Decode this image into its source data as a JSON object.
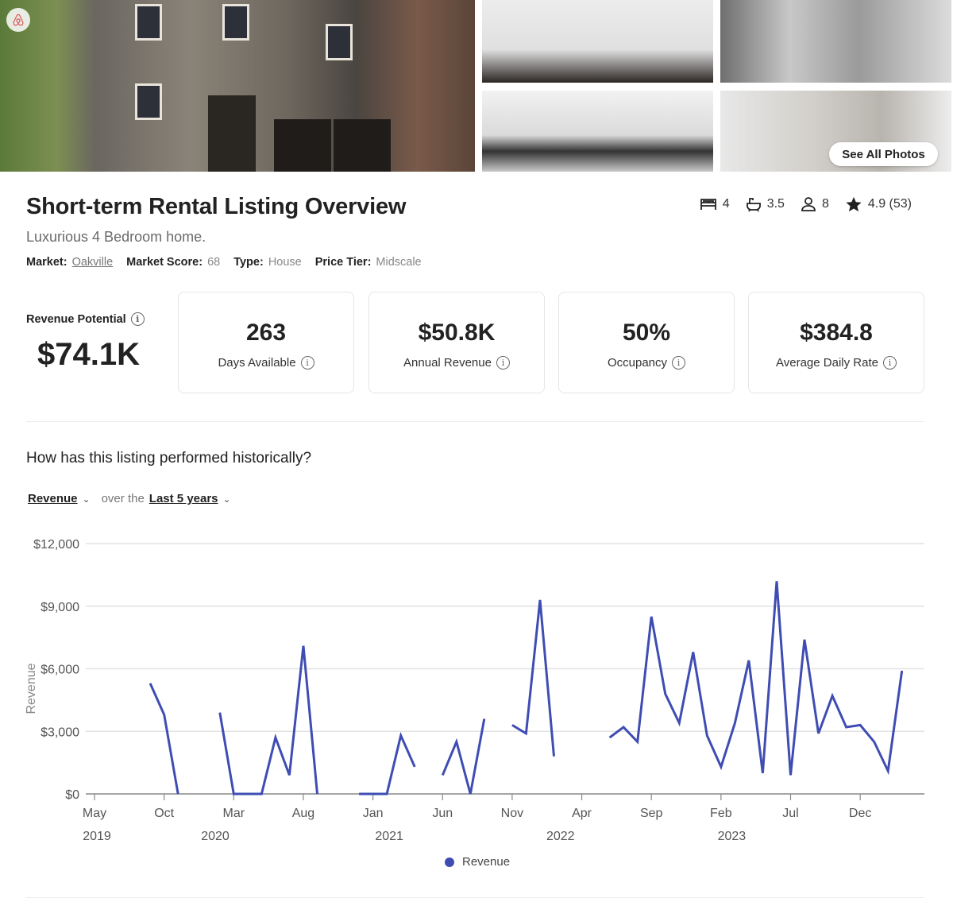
{
  "photos": {
    "see_all_label": "See All Photos"
  },
  "header": {
    "title": "Short-term Rental Listing Overview",
    "subtitle": "Luxurious 4 Bedroom home.",
    "meta": [
      {
        "label": "Market:",
        "value": "Oakville"
      },
      {
        "label": "Market Score:",
        "value": "68"
      },
      {
        "label": "Type:",
        "value": "House"
      },
      {
        "label": "Price Tier:",
        "value": "Midscale"
      }
    ],
    "stats": {
      "bedrooms": "4",
      "bathrooms": "3.5",
      "guests": "8",
      "rating": "4.9 (53)"
    }
  },
  "revenue_potential": {
    "label": "Revenue Potential",
    "value": "$74.1K"
  },
  "cards": [
    {
      "value": "263",
      "label": "Days Available"
    },
    {
      "value": "$50.8K",
      "label": "Annual Revenue"
    },
    {
      "value": "50%",
      "label": "Occupancy"
    },
    {
      "value": "$384.8",
      "label": "Average Daily Rate"
    }
  ],
  "history": {
    "question": "How has this listing performed historically?",
    "metric": "Revenue",
    "connector": "over the",
    "period": "Last 5 years"
  },
  "colors": {
    "line": "#3f4db3"
  },
  "chart_data": {
    "type": "line",
    "ylabel": "Revenue",
    "xlabel": "",
    "ylim": [
      0,
      12000
    ],
    "y_ticks": [
      "$0",
      "$3,000",
      "$6,000",
      "$9,000",
      "$12,000"
    ],
    "y_tick_values": [
      0,
      3000,
      6000,
      9000,
      12000
    ],
    "x_start_month": "2019-05",
    "x_ticks": [
      {
        "month_index": 0,
        "label": "May"
      },
      {
        "month_index": 5,
        "label": "Oct"
      },
      {
        "month_index": 10,
        "label": "Mar"
      },
      {
        "month_index": 15,
        "label": "Aug"
      },
      {
        "month_index": 20,
        "label": "Jan"
      },
      {
        "month_index": 25,
        "label": "Jun"
      },
      {
        "month_index": 30,
        "label": "Nov"
      },
      {
        "month_index": 35,
        "label": "Apr"
      },
      {
        "month_index": 40,
        "label": "Sep"
      },
      {
        "month_index": 45,
        "label": "Feb"
      },
      {
        "month_index": 50,
        "label": "Jul"
      },
      {
        "month_index": 55,
        "label": "Dec"
      }
    ],
    "year_labels": [
      {
        "month_index": 0,
        "label": "2019"
      },
      {
        "month_index": 8.5,
        "label": "2020"
      },
      {
        "month_index": 21,
        "label": "2021"
      },
      {
        "month_index": 33.3,
        "label": "2022"
      },
      {
        "month_index": 45.6,
        "label": "2023"
      }
    ],
    "series": [
      {
        "name": "Revenue",
        "values": [
          null,
          null,
          null,
          null,
          5300,
          3800,
          0,
          null,
          null,
          3900,
          0,
          0,
          0,
          2700,
          900,
          7100,
          0,
          null,
          null,
          0,
          0,
          0,
          2800,
          1300,
          null,
          900,
          2500,
          0,
          3600,
          null,
          3300,
          2900,
          9300,
          1800,
          null,
          null,
          null,
          2700,
          3200,
          2500,
          8500,
          4800,
          3400,
          6800,
          2800,
          1300,
          3400,
          6400,
          1000,
          10200,
          900,
          7400,
          2900,
          4700,
          3200,
          3300,
          2500,
          1100,
          5900
        ]
      }
    ],
    "legend": "bottom-center",
    "grid": true
  }
}
